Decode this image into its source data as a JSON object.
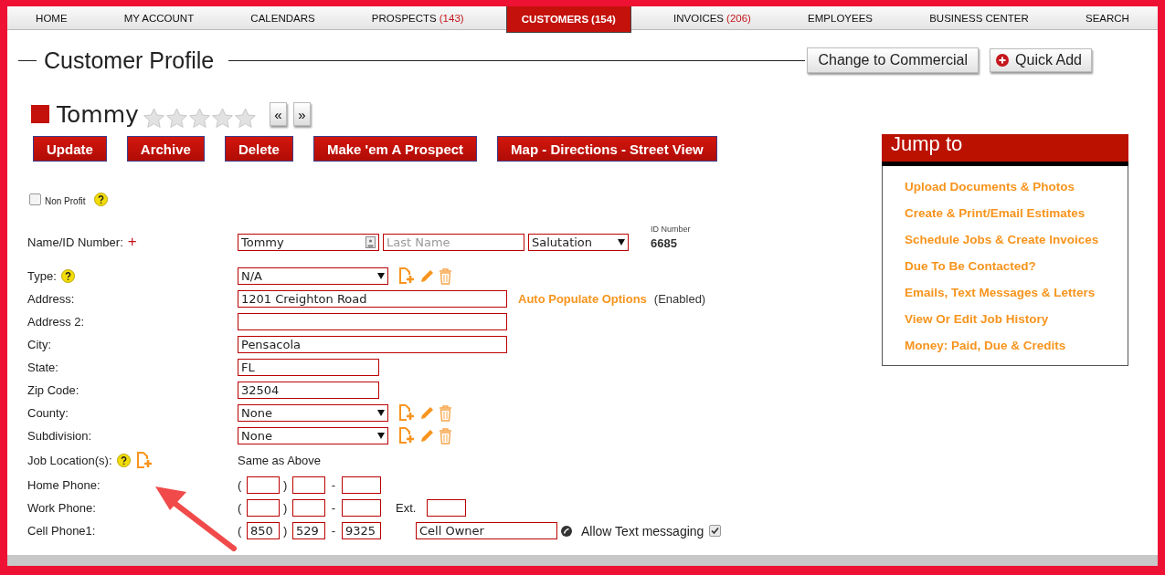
{
  "nav": [
    {
      "label": "HOME",
      "selected": false
    },
    {
      "label": "MY ACCOUNT",
      "selected": false
    },
    {
      "label": "CALENDARS",
      "selected": false
    },
    {
      "label": "PROSPECTS",
      "count": "(143)",
      "selected": false
    },
    {
      "label": "CUSTOMERS",
      "count": "(154)",
      "selected": true
    },
    {
      "label": "INVOICES",
      "count": "(206)",
      "selected": false
    },
    {
      "label": "EMPLOYEES",
      "selected": false
    },
    {
      "label": "BUSINESS CENTER",
      "selected": false
    },
    {
      "label": "SEARCH",
      "selected": false
    }
  ],
  "header": {
    "title": "Customer Profile",
    "commercial_button": "Change to Commercial",
    "quick_add_button": "Quick Add"
  },
  "profile": {
    "name": "Tommy",
    "stars": 0,
    "prev": "«",
    "next": "»"
  },
  "actions": [
    "Update",
    "Archive",
    "Delete",
    "Make 'em A Prospect",
    "Map - Directions - Street View"
  ],
  "non_profit": {
    "label": "Non Profit",
    "checked": false
  },
  "form": {
    "rows": [
      {
        "kind": "name",
        "label": "Name/ID Number:",
        "required": "+",
        "first_name": "Tommy",
        "last_name_placeholder": "Last Name",
        "salutation": "Salutation",
        "id_label": "ID Number",
        "id_value": "6685"
      },
      {
        "kind": "select",
        "label": "Type:",
        "help": true,
        "value": "N/A"
      },
      {
        "kind": "text",
        "label": "Address:",
        "value": "1201 Creighton Road",
        "link": "Auto Populate Options",
        "note": "(Enabled)"
      },
      {
        "kind": "text",
        "label": "Address 2:"
      },
      {
        "kind": "text",
        "label": "City:",
        "value": "Pensacola"
      },
      {
        "kind": "short",
        "label": "State:",
        "value": "FL"
      },
      {
        "kind": "short",
        "label": "Zip Code:",
        "value": "32504"
      },
      {
        "kind": "select",
        "label": "County:",
        "value": "None"
      },
      {
        "kind": "select",
        "label": "Subdivision:",
        "value": "None"
      },
      {
        "kind": "location",
        "label": "Job Location(s):",
        "help": true,
        "value": "Same as Above"
      },
      {
        "kind": "phone",
        "label": "Home Phone:",
        "open": "(",
        "close": ")",
        "dash": "-"
      },
      {
        "kind": "phone",
        "label": "Work Phone:",
        "open": "(",
        "close": ")",
        "dash": "-",
        "ext_label": "Ext."
      },
      {
        "kind": "phone",
        "label": "Cell Phone1:",
        "open": "(",
        "close": ")",
        "dash": "-",
        "area": "850",
        "prefix": "529",
        "line": "9325",
        "owner": "Cell Owner",
        "text_label": "Allow Text messaging",
        "text_allowed": true
      }
    ]
  },
  "jump_to": {
    "title": "Jump to",
    "links": [
      "Upload Documents & Photos",
      "Create & Print/Email Estimates",
      "Schedule Jobs & Create Invoices",
      "Due To Be Contacted?",
      "Emails, Text Messages & Letters",
      "View Or Edit Job History",
      "Money: Paid, Due & Credits"
    ]
  }
}
